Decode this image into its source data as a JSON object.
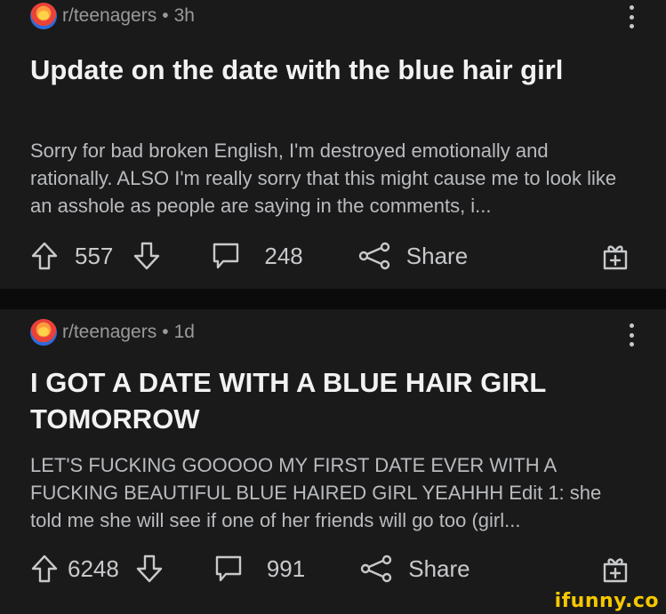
{
  "posts": [
    {
      "subreddit": "r/teenagers",
      "age": "3h",
      "title": "Update on the date with the blue hair girl",
      "body": "Sorry for bad broken English, I'm destroyed emotionally and rationally. ALSO I'm really sorry that this might cause me to look like an asshole as people are saying in the comments, i...",
      "upvotes": "557",
      "comments": "248",
      "share_label": "Share"
    },
    {
      "subreddit": "r/teenagers",
      "age": "1d",
      "title": "I GOT A DATE WITH A BLUE HAIR GIRL TOMORROW",
      "body": "LET'S FUCKING GOOOOO MY FIRST DATE EVER WITH A FUCKING BEAUTIFUL BLUE HAIRED GIRL YEAHHH Edit 1: she told me she will see if one of her friends will go too (girl...",
      "upvotes": "6248",
      "comments": "991",
      "share_label": "Share"
    }
  ],
  "separator": "•",
  "watermark": "ifunny.co",
  "colors": {
    "background": "#0b0b0b",
    "card": "#1a1a1b",
    "watermark": "#f5c800"
  }
}
